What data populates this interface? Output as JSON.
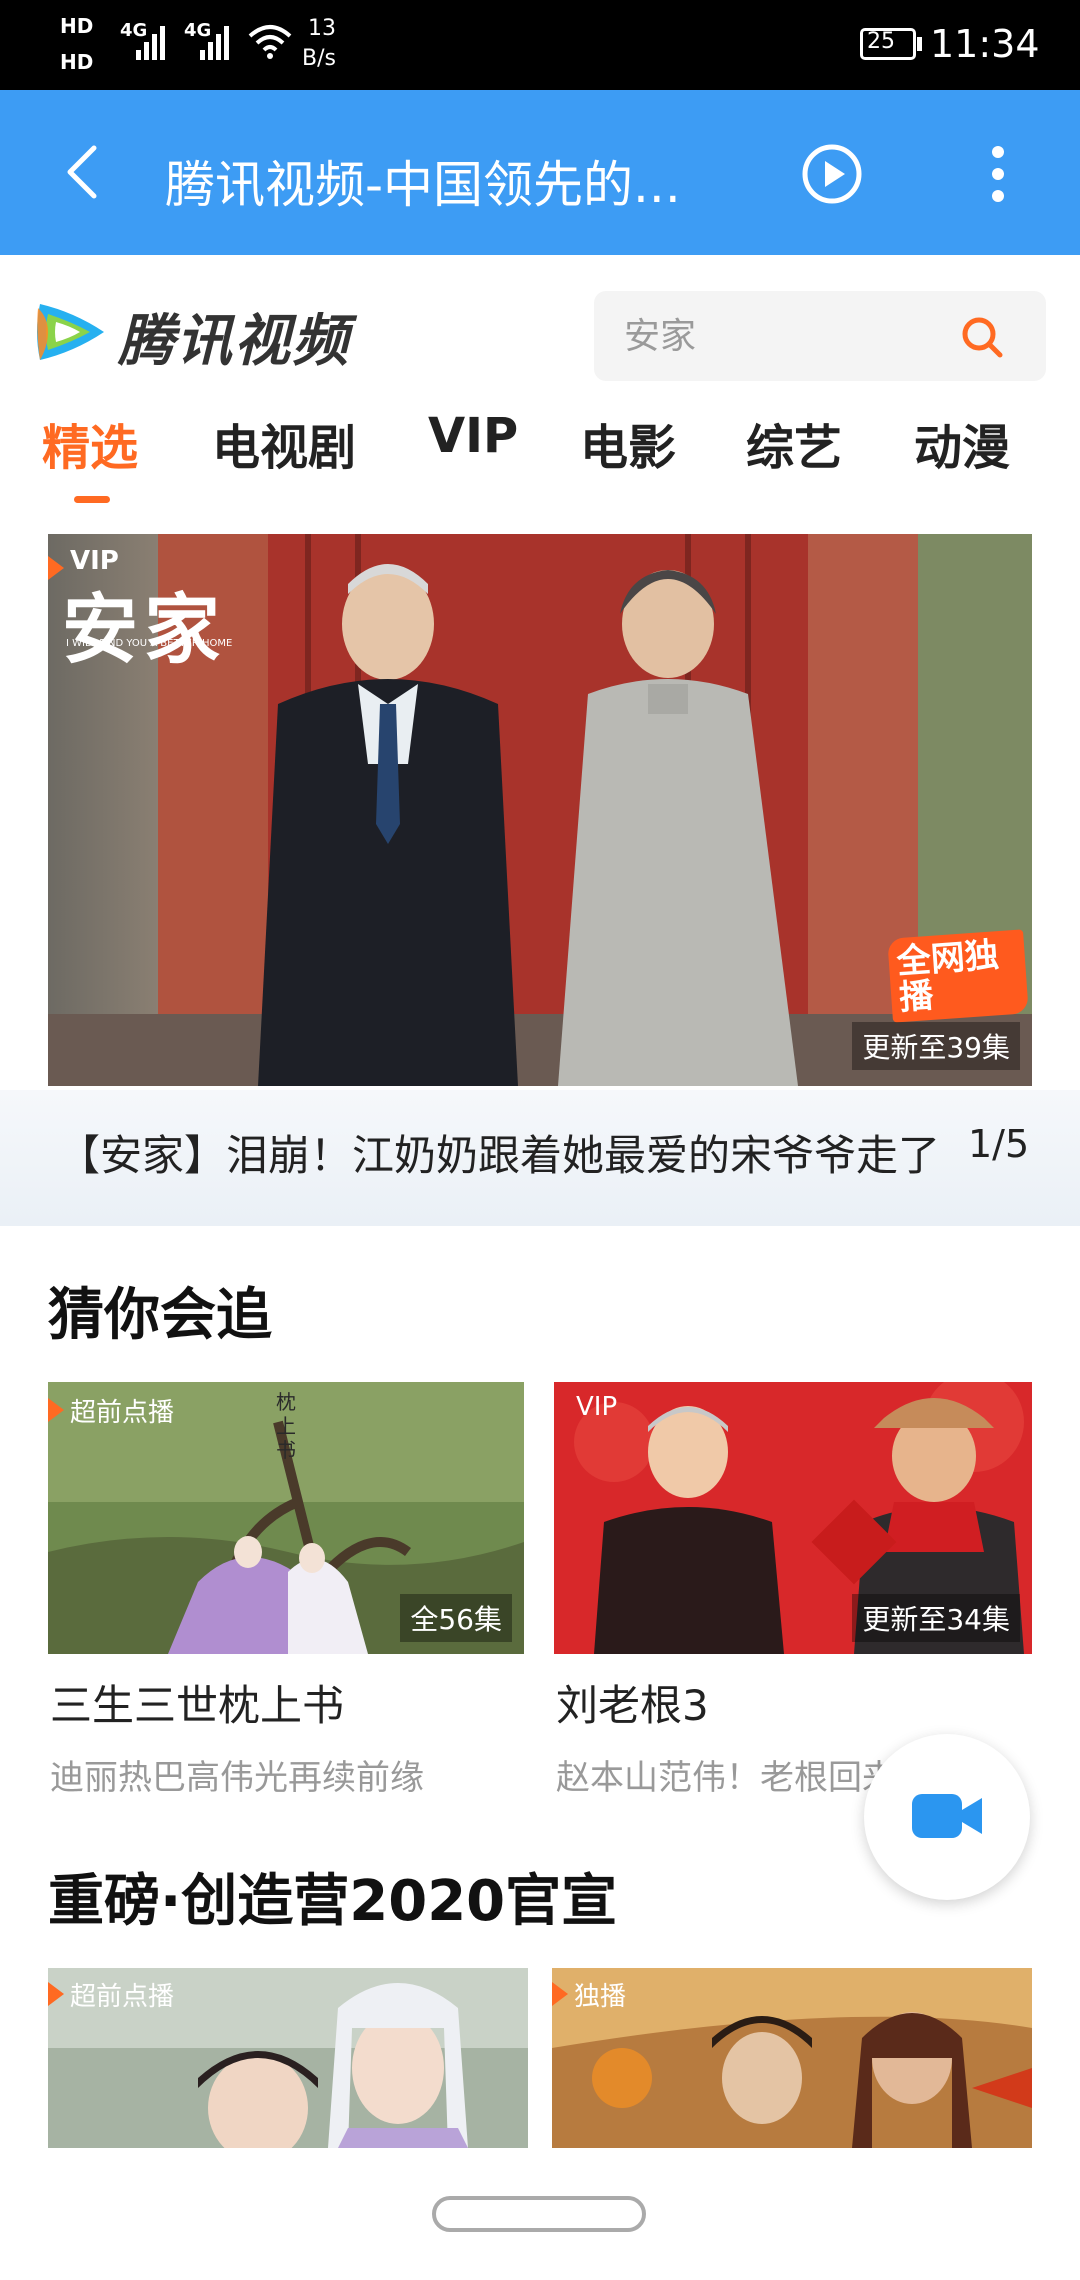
{
  "status_bar": {
    "hd1": "HD",
    "hd2": "HD",
    "net1": "4G",
    "net2": "4G",
    "speed_value": "13",
    "speed_unit": "B/s",
    "battery": "25",
    "time": "11:34"
  },
  "app_bar": {
    "title": "腾讯视频-中国领先的..."
  },
  "header": {
    "logo_text": "腾讯视频",
    "search_placeholder": "安家"
  },
  "tabs": [
    {
      "label": "精选",
      "active": true
    },
    {
      "label": "电视剧",
      "active": false
    },
    {
      "label": "VIP",
      "active": false
    },
    {
      "label": "电影",
      "active": false
    },
    {
      "label": "综艺",
      "active": false
    },
    {
      "label": "动漫",
      "active": false
    }
  ],
  "banner": {
    "vip_tag": "VIP",
    "show_title": "安家",
    "show_subtitle": "I WILL FIND YOU A BETTER HOME",
    "exclusive_badge": "全网独播",
    "update_status": "更新至39集",
    "caption": "【安家】泪崩！江奶奶跟着她最爱的宋爷爷走了",
    "pager": "1/5"
  },
  "section_guess": {
    "title": "猜你会追",
    "cards": [
      {
        "tag": "超前点播",
        "corner_text": "全56集",
        "title": "三生三世枕上书",
        "subtitle": "迪丽热巴高伟光再续前缘",
        "poster_text": "枕上书"
      },
      {
        "tag": "VIP",
        "corner_text": "更新至34集",
        "title": "刘老根3",
        "subtitle": "赵本山范伟！老根回来啦"
      }
    ]
  },
  "section_chuang": {
    "title": "重磅·创造营2020官宣",
    "cards": [
      {
        "tag": "超前点播"
      },
      {
        "tag": "独播"
      }
    ]
  },
  "colors": {
    "app_bar": "#3d9cf4",
    "accent": "#ff6a22",
    "fab_icon": "#2b96f0"
  },
  "icons": {
    "back": "chevron-left-icon",
    "play": "play-circle-icon",
    "more": "more-vertical-icon",
    "search": "search-icon",
    "camera": "video-camera-icon"
  }
}
